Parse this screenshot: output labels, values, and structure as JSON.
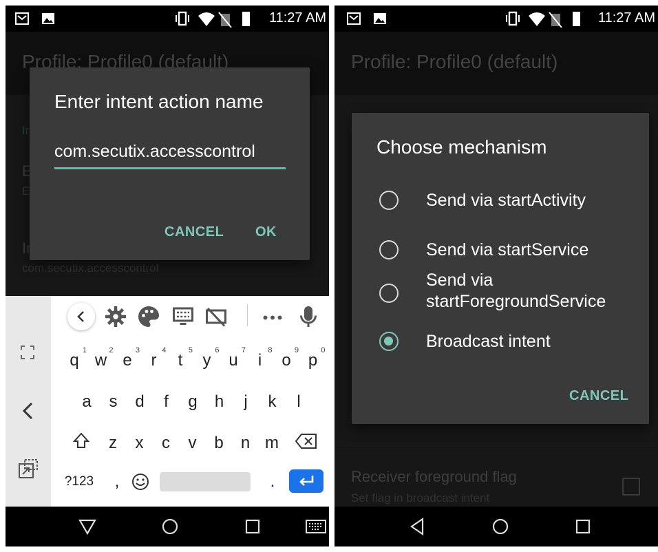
{
  "status_bar": {
    "time": "11:27 AM",
    "notification_icons": [
      "gmail-icon",
      "image-icon"
    ],
    "system_icons": [
      "vibrate-icon",
      "wifi-icon",
      "no-sim-icon",
      "battery-icon"
    ]
  },
  "left": {
    "app_title": "Profile: Profile0 (default)",
    "background_rows": {
      "row1_initial": "In",
      "row2_initial": "E",
      "row2_sub_initial": "E",
      "row3_initial": "In",
      "row3_summary": "com.secutix.accesscontrol"
    },
    "dialog": {
      "title": "Enter intent action name",
      "input_value": "com.secutix.accesscontrol",
      "cancel_label": "CANCEL",
      "ok_label": "OK"
    },
    "keyboard": {
      "toolbar": [
        "back-icon",
        "gear-icon",
        "palette-icon",
        "keyboard-layout-icon",
        "hide-suggestions-icon",
        "more-icon",
        "mic-icon"
      ],
      "row1": [
        {
          "key": "q",
          "hint": "1"
        },
        {
          "key": "w",
          "hint": "2"
        },
        {
          "key": "e",
          "hint": "3"
        },
        {
          "key": "r",
          "hint": "4"
        },
        {
          "key": "t",
          "hint": "5"
        },
        {
          "key": "y",
          "hint": "6"
        },
        {
          "key": "u",
          "hint": "7"
        },
        {
          "key": "i",
          "hint": "8"
        },
        {
          "key": "o",
          "hint": "9"
        },
        {
          "key": "p",
          "hint": "0"
        }
      ],
      "row2": [
        "a",
        "s",
        "d",
        "f",
        "g",
        "h",
        "j",
        "k",
        "l"
      ],
      "row3": [
        "z",
        "x",
        "c",
        "v",
        "b",
        "n",
        "m"
      ],
      "symbols_label": "?123",
      "comma_label": ",",
      "period_label": "."
    }
  },
  "right": {
    "app_title": "Profile: Profile0 (default)",
    "dialog": {
      "title": "Choose mechanism",
      "options": [
        {
          "label": "Send via startActivity",
          "selected": false
        },
        {
          "label": "Send via startService",
          "selected": false
        },
        {
          "label": "Send via startForegroundService",
          "selected": false
        },
        {
          "label": "Broadcast intent",
          "selected": true
        }
      ],
      "cancel_label": "CANCEL"
    },
    "background_rows": {
      "mechanism_summary": "Broadcast intent",
      "foreground_title": "Receiver foreground flag",
      "foreground_summary": "Set flag in broadcast intent",
      "foreground_checked": false
    }
  },
  "colors": {
    "accent": "#7fc7b7",
    "dialog_bg": "#3a3a3a",
    "status_bar": "#000000",
    "enter_key": "#1a73e8"
  }
}
